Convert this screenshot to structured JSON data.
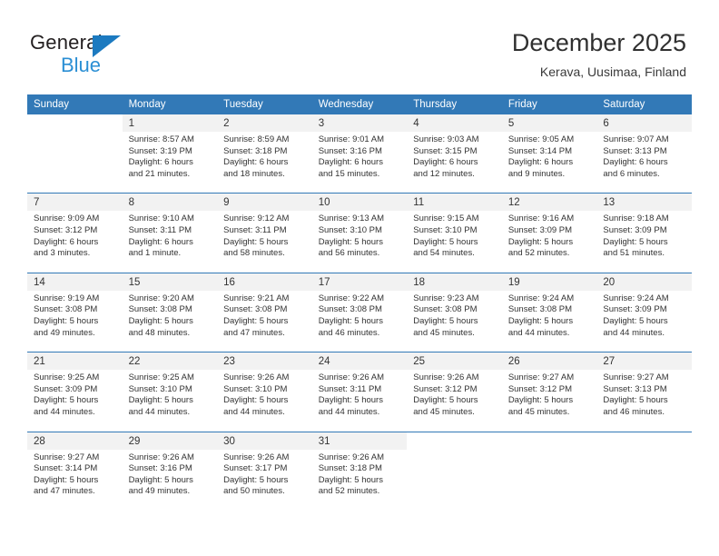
{
  "brand": {
    "name_part1": "General",
    "name_part2": "Blue"
  },
  "header": {
    "title": "December 2025",
    "subtitle": "Kerava, Uusimaa, Finland"
  },
  "colors": {
    "header_blue": "#3279b7",
    "brand_blue": "#2b8fd4",
    "daynum_bg": "#f2f2f2",
    "text": "#333333"
  },
  "weekday_headers": [
    "Sunday",
    "Monday",
    "Tuesday",
    "Wednesday",
    "Thursday",
    "Friday",
    "Saturday"
  ],
  "weeks": [
    [
      {
        "day": "",
        "empty": true
      },
      {
        "day": "1",
        "sunrise": "Sunrise: 8:57 AM",
        "sunset": "Sunset: 3:19 PM",
        "daylight1": "Daylight: 6 hours",
        "daylight2": "and 21 minutes."
      },
      {
        "day": "2",
        "sunrise": "Sunrise: 8:59 AM",
        "sunset": "Sunset: 3:18 PM",
        "daylight1": "Daylight: 6 hours",
        "daylight2": "and 18 minutes."
      },
      {
        "day": "3",
        "sunrise": "Sunrise: 9:01 AM",
        "sunset": "Sunset: 3:16 PM",
        "daylight1": "Daylight: 6 hours",
        "daylight2": "and 15 minutes."
      },
      {
        "day": "4",
        "sunrise": "Sunrise: 9:03 AM",
        "sunset": "Sunset: 3:15 PM",
        "daylight1": "Daylight: 6 hours",
        "daylight2": "and 12 minutes."
      },
      {
        "day": "5",
        "sunrise": "Sunrise: 9:05 AM",
        "sunset": "Sunset: 3:14 PM",
        "daylight1": "Daylight: 6 hours",
        "daylight2": "and 9 minutes."
      },
      {
        "day": "6",
        "sunrise": "Sunrise: 9:07 AM",
        "sunset": "Sunset: 3:13 PM",
        "daylight1": "Daylight: 6 hours",
        "daylight2": "and 6 minutes."
      }
    ],
    [
      {
        "day": "7",
        "sunrise": "Sunrise: 9:09 AM",
        "sunset": "Sunset: 3:12 PM",
        "daylight1": "Daylight: 6 hours",
        "daylight2": "and 3 minutes."
      },
      {
        "day": "8",
        "sunrise": "Sunrise: 9:10 AM",
        "sunset": "Sunset: 3:11 PM",
        "daylight1": "Daylight: 6 hours",
        "daylight2": "and 1 minute."
      },
      {
        "day": "9",
        "sunrise": "Sunrise: 9:12 AM",
        "sunset": "Sunset: 3:11 PM",
        "daylight1": "Daylight: 5 hours",
        "daylight2": "and 58 minutes."
      },
      {
        "day": "10",
        "sunrise": "Sunrise: 9:13 AM",
        "sunset": "Sunset: 3:10 PM",
        "daylight1": "Daylight: 5 hours",
        "daylight2": "and 56 minutes."
      },
      {
        "day": "11",
        "sunrise": "Sunrise: 9:15 AM",
        "sunset": "Sunset: 3:10 PM",
        "daylight1": "Daylight: 5 hours",
        "daylight2": "and 54 minutes."
      },
      {
        "day": "12",
        "sunrise": "Sunrise: 9:16 AM",
        "sunset": "Sunset: 3:09 PM",
        "daylight1": "Daylight: 5 hours",
        "daylight2": "and 52 minutes."
      },
      {
        "day": "13",
        "sunrise": "Sunrise: 9:18 AM",
        "sunset": "Sunset: 3:09 PM",
        "daylight1": "Daylight: 5 hours",
        "daylight2": "and 51 minutes."
      }
    ],
    [
      {
        "day": "14",
        "sunrise": "Sunrise: 9:19 AM",
        "sunset": "Sunset: 3:08 PM",
        "daylight1": "Daylight: 5 hours",
        "daylight2": "and 49 minutes."
      },
      {
        "day": "15",
        "sunrise": "Sunrise: 9:20 AM",
        "sunset": "Sunset: 3:08 PM",
        "daylight1": "Daylight: 5 hours",
        "daylight2": "and 48 minutes."
      },
      {
        "day": "16",
        "sunrise": "Sunrise: 9:21 AM",
        "sunset": "Sunset: 3:08 PM",
        "daylight1": "Daylight: 5 hours",
        "daylight2": "and 47 minutes."
      },
      {
        "day": "17",
        "sunrise": "Sunrise: 9:22 AM",
        "sunset": "Sunset: 3:08 PM",
        "daylight1": "Daylight: 5 hours",
        "daylight2": "and 46 minutes."
      },
      {
        "day": "18",
        "sunrise": "Sunrise: 9:23 AM",
        "sunset": "Sunset: 3:08 PM",
        "daylight1": "Daylight: 5 hours",
        "daylight2": "and 45 minutes."
      },
      {
        "day": "19",
        "sunrise": "Sunrise: 9:24 AM",
        "sunset": "Sunset: 3:08 PM",
        "daylight1": "Daylight: 5 hours",
        "daylight2": "and 44 minutes."
      },
      {
        "day": "20",
        "sunrise": "Sunrise: 9:24 AM",
        "sunset": "Sunset: 3:09 PM",
        "daylight1": "Daylight: 5 hours",
        "daylight2": "and 44 minutes."
      }
    ],
    [
      {
        "day": "21",
        "sunrise": "Sunrise: 9:25 AM",
        "sunset": "Sunset: 3:09 PM",
        "daylight1": "Daylight: 5 hours",
        "daylight2": "and 44 minutes."
      },
      {
        "day": "22",
        "sunrise": "Sunrise: 9:25 AM",
        "sunset": "Sunset: 3:10 PM",
        "daylight1": "Daylight: 5 hours",
        "daylight2": "and 44 minutes."
      },
      {
        "day": "23",
        "sunrise": "Sunrise: 9:26 AM",
        "sunset": "Sunset: 3:10 PM",
        "daylight1": "Daylight: 5 hours",
        "daylight2": "and 44 minutes."
      },
      {
        "day": "24",
        "sunrise": "Sunrise: 9:26 AM",
        "sunset": "Sunset: 3:11 PM",
        "daylight1": "Daylight: 5 hours",
        "daylight2": "and 44 minutes."
      },
      {
        "day": "25",
        "sunrise": "Sunrise: 9:26 AM",
        "sunset": "Sunset: 3:12 PM",
        "daylight1": "Daylight: 5 hours",
        "daylight2": "and 45 minutes."
      },
      {
        "day": "26",
        "sunrise": "Sunrise: 9:27 AM",
        "sunset": "Sunset: 3:12 PM",
        "daylight1": "Daylight: 5 hours",
        "daylight2": "and 45 minutes."
      },
      {
        "day": "27",
        "sunrise": "Sunrise: 9:27 AM",
        "sunset": "Sunset: 3:13 PM",
        "daylight1": "Daylight: 5 hours",
        "daylight2": "and 46 minutes."
      }
    ],
    [
      {
        "day": "28",
        "sunrise": "Sunrise: 9:27 AM",
        "sunset": "Sunset: 3:14 PM",
        "daylight1": "Daylight: 5 hours",
        "daylight2": "and 47 minutes."
      },
      {
        "day": "29",
        "sunrise": "Sunrise: 9:26 AM",
        "sunset": "Sunset: 3:16 PM",
        "daylight1": "Daylight: 5 hours",
        "daylight2": "and 49 minutes."
      },
      {
        "day": "30",
        "sunrise": "Sunrise: 9:26 AM",
        "sunset": "Sunset: 3:17 PM",
        "daylight1": "Daylight: 5 hours",
        "daylight2": "and 50 minutes."
      },
      {
        "day": "31",
        "sunrise": "Sunrise: 9:26 AM",
        "sunset": "Sunset: 3:18 PM",
        "daylight1": "Daylight: 5 hours",
        "daylight2": "and 52 minutes."
      },
      {
        "day": "",
        "empty": true
      },
      {
        "day": "",
        "empty": true
      },
      {
        "day": "",
        "empty": true
      }
    ]
  ]
}
